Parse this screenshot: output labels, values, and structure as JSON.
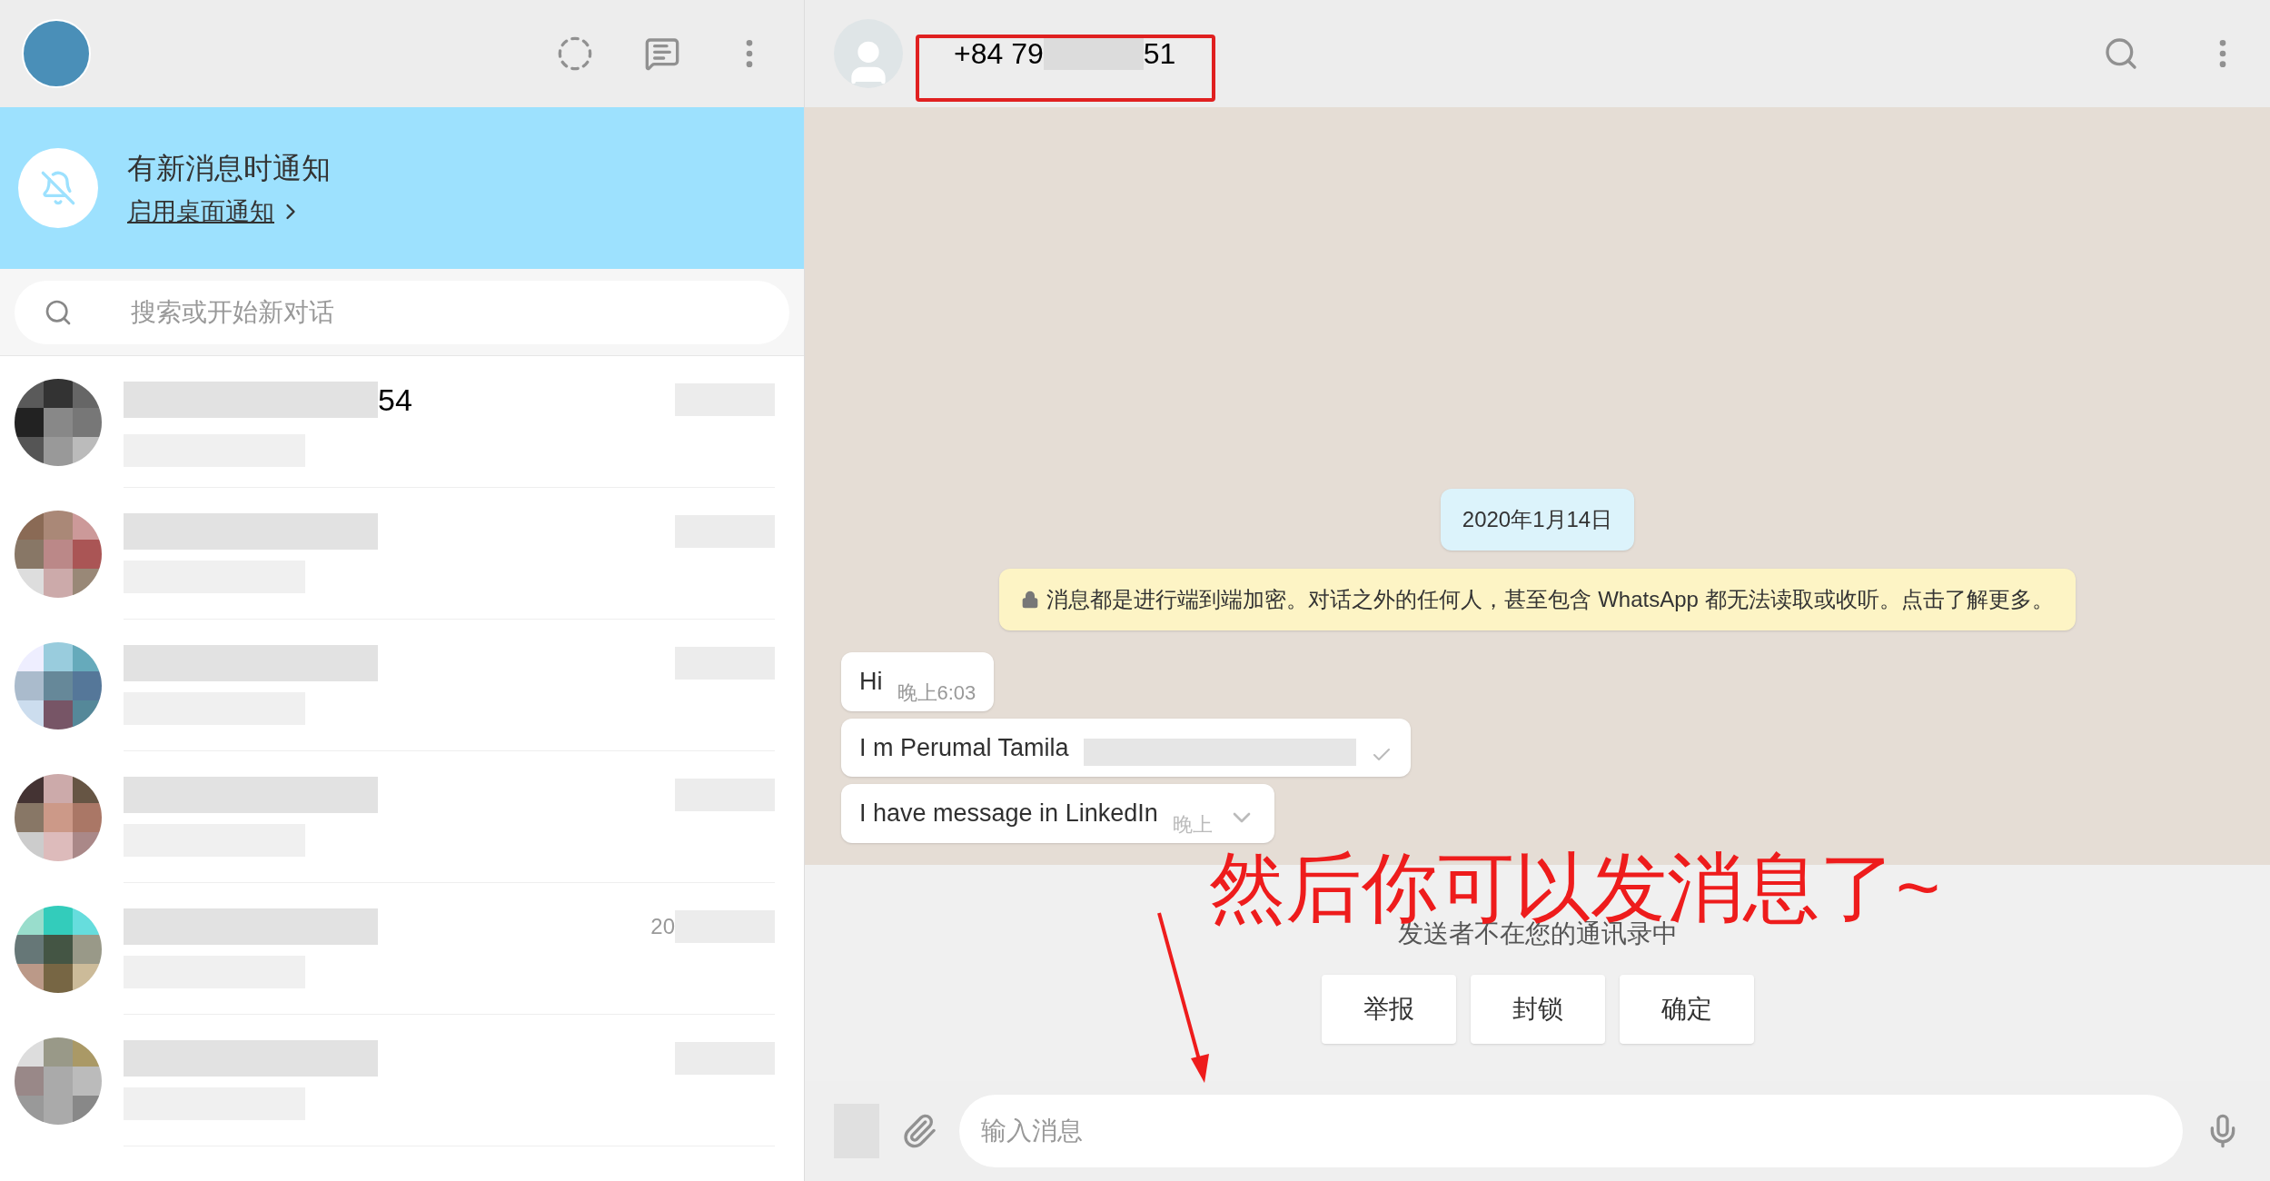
{
  "notification": {
    "title": "有新消息时通知",
    "link": "启用桌面通知"
  },
  "search": {
    "placeholder": "搜索或开始新对话"
  },
  "chats": [
    {
      "kind": "blurred",
      "name_tail": "54"
    },
    {
      "kind": "blurred"
    },
    {
      "kind": "blurred"
    },
    {
      "kind": "blurred"
    },
    {
      "kind": "blurred",
      "time_start": "20"
    },
    {
      "kind": "blurred"
    }
  ],
  "chat": {
    "number_start": "+84 79",
    "number_end": "51",
    "date": "2020年1月14日",
    "encryption_notice": "消息都是进行端到端加密。对话之外的任何人，甚至包含 WhatsApp 都无法读取或收听。点击了解更多。",
    "messages": [
      {
        "kind": "plain",
        "text": "Hi",
        "time": "晚上6:03"
      },
      {
        "kind": "redacted",
        "text": "I m Perumal Tamila"
      },
      {
        "kind": "menu",
        "text": "I have message in LinkedIn",
        "time": "晚上"
      }
    ]
  },
  "unknown_sender": {
    "notice": "发送者不在您的通讯录中",
    "buttons": [
      "举报",
      "封锁",
      "确定"
    ]
  },
  "composer": {
    "placeholder": "输入消息"
  },
  "annotation": {
    "text": "然后你可以发消息了~"
  }
}
